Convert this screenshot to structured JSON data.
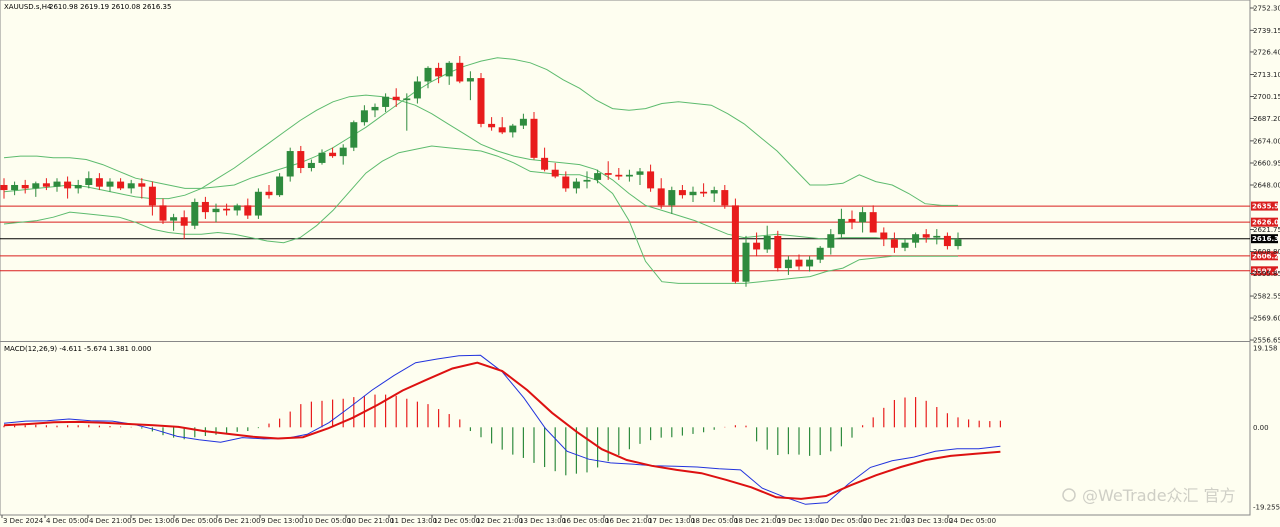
{
  "colors": {
    "background": "#fefef0",
    "bull": "#2e8b3e",
    "bear": "#e81c1c",
    "bands": "#5dbb6e",
    "level": "#d91e1e",
    "current": "#000000",
    "macd_line": "#2233dd",
    "signal_line": "#dd1111"
  },
  "chart_data": [
    {
      "type": "candlestick",
      "symbol_label": "XAUUSD.s,H4",
      "ohlc_label": "2610.98 2619.19 2610.08 2616.35",
      "ylim": [
        2556.65,
        2752.3
      ],
      "y_ticks": [
        "2752.30",
        "2739.15",
        "2726.40",
        "2713.10",
        "2700.15",
        "2687.20",
        "2674.00",
        "2660.95",
        "2648.00",
        "2621.75",
        "2608.80",
        "2595.85",
        "2582.55",
        "2569.60",
        "2556.65"
      ],
      "price_levels": [
        {
          "value": 2635.57,
          "label": "2635.57"
        },
        {
          "value": 2626.09,
          "label": "2626.09"
        },
        {
          "value": 2606.26,
          "label": "2606.26"
        },
        {
          "value": 2597.43,
          "label": "2597.43"
        }
      ],
      "current_price": {
        "value": 2616.35,
        "label": "2616.35"
      },
      "candles": [
        [
          2648,
          2652,
          2640,
          2645
        ],
        [
          2645,
          2650,
          2642,
          2648
        ],
        [
          2648,
          2651,
          2643,
          2646
        ],
        [
          2646,
          2650,
          2641,
          2649
        ],
        [
          2649,
          2652,
          2645,
          2647
        ],
        [
          2647,
          2652,
          2644,
          2650
        ],
        [
          2650,
          2653,
          2640,
          2646
        ],
        [
          2646,
          2651,
          2643,
          2648
        ],
        [
          2648,
          2656,
          2646,
          2652
        ],
        [
          2652,
          2655,
          2645,
          2647
        ],
        [
          2647,
          2652,
          2644,
          2650
        ],
        [
          2650,
          2652,
          2645,
          2646
        ],
        [
          2646,
          2651,
          2643,
          2649
        ],
        [
          2649,
          2652,
          2640,
          2647
        ],
        [
          2647,
          2650,
          2630,
          2636
        ],
        [
          2636,
          2640,
          2625,
          2627
        ],
        [
          2627,
          2631,
          2621,
          2629
        ],
        [
          2629,
          2633,
          2616,
          2624
        ],
        [
          2624,
          2640,
          2622,
          2638
        ],
        [
          2638,
          2641,
          2628,
          2632
        ],
        [
          2632,
          2637,
          2626,
          2634
        ],
        [
          2634,
          2637,
          2630,
          2633
        ],
        [
          2633,
          2637,
          2630,
          2636
        ],
        [
          2636,
          2640,
          2628,
          2630
        ],
        [
          2630,
          2646,
          2628,
          2644
        ],
        [
          2644,
          2648,
          2640,
          2642
        ],
        [
          2642,
          2655,
          2641,
          2653
        ],
        [
          2653,
          2670,
          2650,
          2668
        ],
        [
          2668,
          2671,
          2655,
          2658
        ],
        [
          2658,
          2663,
          2656,
          2661
        ],
        [
          2661,
          2669,
          2660,
          2667
        ],
        [
          2667,
          2670,
          2664,
          2665
        ],
        [
          2665,
          2672,
          2660,
          2670
        ],
        [
          2670,
          2686,
          2668,
          2685
        ],
        [
          2685,
          2695,
          2683,
          2692
        ],
        [
          2692,
          2696,
          2688,
          2694
        ],
        [
          2694,
          2702,
          2691,
          2700
        ],
        [
          2700,
          2705,
          2694,
          2698
        ],
        [
          2698,
          2702,
          2680,
          2699
        ],
        [
          2699,
          2712,
          2696,
          2709
        ],
        [
          2709,
          2718,
          2705,
          2717
        ],
        [
          2717,
          2720,
          2708,
          2712
        ],
        [
          2712,
          2721,
          2707,
          2720
        ],
        [
          2720,
          2724,
          2708,
          2709
        ],
        [
          2709,
          2715,
          2698,
          2711
        ],
        [
          2711,
          2714,
          2682,
          2684
        ],
        [
          2684,
          2688,
          2680,
          2682
        ],
        [
          2682,
          2688,
          2678,
          2679
        ],
        [
          2679,
          2684,
          2676,
          2683
        ],
        [
          2683,
          2690,
          2681,
          2687
        ],
        [
          2687,
          2691,
          2663,
          2664
        ],
        [
          2664,
          2670,
          2656,
          2657
        ],
        [
          2657,
          2661,
          2652,
          2653
        ],
        [
          2653,
          2656,
          2644,
          2646
        ],
        [
          2646,
          2652,
          2643,
          2650
        ],
        [
          2650,
          2656,
          2646,
          2651
        ],
        [
          2651,
          2657,
          2649,
          2655
        ],
        [
          2655,
          2662,
          2651,
          2654
        ],
        [
          2654,
          2658,
          2651,
          2653
        ],
        [
          2653,
          2657,
          2650,
          2654
        ],
        [
          2654,
          2658,
          2648,
          2656
        ],
        [
          2656,
          2660,
          2644,
          2646
        ],
        [
          2646,
          2652,
          2634,
          2636
        ],
        [
          2636,
          2647,
          2631,
          2645
        ],
        [
          2645,
          2648,
          2640,
          2642
        ],
        [
          2642,
          2647,
          2638,
          2644
        ],
        [
          2644,
          2649,
          2641,
          2643
        ],
        [
          2643,
          2647,
          2638,
          2645
        ],
        [
          2645,
          2648,
          2634,
          2636
        ],
        [
          2636,
          2640,
          2590,
          2591
        ],
        [
          2591,
          2618,
          2588,
          2614
        ],
        [
          2614,
          2620,
          2606,
          2610
        ],
        [
          2610,
          2624,
          2608,
          2618
        ],
        [
          2618,
          2621,
          2597,
          2599
        ],
        [
          2599,
          2606,
          2595,
          2604
        ],
        [
          2604,
          2607,
          2598,
          2600
        ],
        [
          2600,
          2606,
          2597,
          2604
        ],
        [
          2604,
          2612,
          2602,
          2611
        ],
        [
          2611,
          2622,
          2607,
          2619
        ],
        [
          2619,
          2634,
          2617,
          2628
        ],
        [
          2628,
          2633,
          2622,
          2626
        ],
        [
          2626,
          2635,
          2620,
          2632
        ],
        [
          2632,
          2636,
          2621,
          2620
        ],
        [
          2620,
          2623,
          2612,
          2616
        ],
        [
          2616,
          2620,
          2608,
          2611
        ],
        [
          2611,
          2616,
          2609,
          2614
        ],
        [
          2614,
          2620,
          2611,
          2619
        ],
        [
          2619,
          2622,
          2614,
          2617
        ],
        [
          2617,
          2622,
          2613,
          2618
        ],
        [
          2618,
          2620,
          2610,
          2612
        ],
        [
          2612,
          2620,
          2610,
          2616
        ]
      ],
      "band_upper": [
        2664,
        2665,
        2665,
        2664,
        2664,
        2663,
        2660,
        2656,
        2652,
        2650,
        2648,
        2646,
        2646,
        2647,
        2648,
        2652,
        2655,
        2658,
        2661,
        2665,
        2670,
        2676,
        2682,
        2689,
        2696,
        2703,
        2709,
        2714,
        2718,
        2721,
        2723,
        2722,
        2720,
        2716,
        2710,
        2705,
        2698,
        2693,
        2692,
        2693,
        2696,
        2697,
        2696,
        2695,
        2690,
        2684,
        2676,
        2668,
        2658,
        2648,
        2648,
        2649,
        2654,
        2650,
        2648,
        2643,
        2637,
        2636,
        2636
      ],
      "band_middle": [
        2644,
        2645,
        2646,
        2647,
        2648,
        2647,
        2645,
        2643,
        2641,
        2640,
        2640,
        2642,
        2646,
        2652,
        2658,
        2665,
        2672,
        2679,
        2686,
        2692,
        2697,
        2700,
        2701,
        2700,
        2698,
        2695,
        2690,
        2684,
        2678,
        2672,
        2668,
        2665,
        2663,
        2662,
        2661,
        2660,
        2657,
        2651,
        2643,
        2636,
        2633,
        2630,
        2627,
        2623,
        2619,
        2617,
        2618,
        2619,
        2618,
        2617,
        2616,
        2617,
        2617,
        2617,
        2616,
        2616,
        2616,
        2616,
        2616
      ],
      "band_lower": [
        2625,
        2626,
        2627,
        2629,
        2632,
        2631,
        2630,
        2629,
        2626,
        2622,
        2620,
        2619,
        2619,
        2620,
        2619,
        2617,
        2615,
        2614,
        2617,
        2624,
        2633,
        2644,
        2655,
        2662,
        2667,
        2669,
        2671,
        2670,
        2669,
        2668,
        2665,
        2661,
        2656,
        2655,
        2654,
        2654,
        2651,
        2643,
        2627,
        2603,
        2591,
        2590,
        2590,
        2590,
        2590,
        2590,
        2591,
        2592,
        2593,
        2594,
        2597,
        2599,
        2604,
        2605,
        2606,
        2606,
        2606,
        2606,
        2606
      ],
      "x_labels": [
        "3 Dec 2024",
        "4 Dec 05:00",
        "4 Dec 21:00",
        "5 Dec 13:00",
        "6 Dec 05:00",
        "6 Dec 21:00",
        "9 Dec 13:00",
        "10 Dec 05:00",
        "10 Dec 21:00",
        "11 Dec 13:00",
        "12 Dec 05:00",
        "12 Dec 21:00",
        "13 Dec 13:00",
        "16 Dec 05:00",
        "16 Dec 21:00",
        "17 Dec 13:00",
        "18 Dec 05:00",
        "18 Dec 21:00",
        "19 Dec 13:00",
        "20 Dec 05:00",
        "20 Dec 21:00",
        "23 Dec 13:00",
        "24 Dec 05:00"
      ]
    },
    {
      "type": "macd",
      "label": "MACD(12,26,9) -4.611 -5.674 1.381 0.000",
      "ylim": [
        -19.255,
        19.158
      ],
      "y_ticks": [
        "19.158",
        "0.00",
        "-19.255"
      ],
      "histogram": [
        0.4,
        0.4,
        0.5,
        0.6,
        0.5,
        0.4,
        0.5,
        0.5,
        0.6,
        0.4,
        0.3,
        0.2,
        0.1,
        -0.3,
        -1.0,
        -1.9,
        -2.5,
        -2.9,
        -2.4,
        -2.1,
        -1.8,
        -1.4,
        -1.1,
        -0.9,
        -0.2,
        0.9,
        2.1,
        3.8,
        5.6,
        6.2,
        6.4,
        6.7,
        6.9,
        7.3,
        7.6,
        7.9,
        7.9,
        7.6,
        6.9,
        6.2,
        5.6,
        4.4,
        3.2,
        1.9,
        -0.9,
        -2.4,
        -3.9,
        -5.4,
        -6.6,
        -7.4,
        -8.6,
        -9.6,
        -10.6,
        -11.6,
        -11.2,
        -10.9,
        -9.7,
        -8.2,
        -6.7,
        -5.3,
        -4.0,
        -3.1,
        -2.5,
        -2.4,
        -2.0,
        -1.6,
        -1.2,
        -0.6,
        0.1,
        0.5,
        0.4,
        -3.4,
        -5.4,
        -6.7,
        -6.5,
        -6.6,
        -6.9,
        -6.7,
        -5.8,
        -4.6,
        -2.5,
        0.5,
        2.4,
        4.7,
        6.6,
        7.2,
        7.3,
        6.4,
        4.9,
        3.4,
        2.4,
        1.9,
        1.6,
        1.5,
        1.6
      ],
      "macd_line": [
        1,
        1.5,
        1.6,
        2,
        1.6,
        1.5,
        0.7,
        -0.6,
        -2.2,
        -3,
        -3.6,
        -2.5,
        -2.8,
        -2.7,
        -1.7,
        1.1,
        5,
        9,
        12.5,
        15.6,
        16.5,
        17.3,
        17.4,
        13.4,
        7.1,
        -0.3,
        -5.8,
        -7.7,
        -8.6,
        -8.9,
        -9.3,
        -9.4,
        -9.6,
        -10,
        -10.3,
        -14.7,
        -16.8,
        -18.6,
        -18.2,
        -13.6,
        -9.7,
        -8.1,
        -7.2,
        -5.8,
        -5.2,
        -5.2,
        -4.6
      ],
      "signal_line": [
        0.5,
        0.8,
        1.2,
        1.3,
        1.1,
        0.8,
        0.5,
        0.1,
        -0.9,
        -1.6,
        -2.3,
        -2.7,
        -2.4,
        -0.3,
        2.3,
        5.4,
        8.9,
        11.6,
        14.2,
        15.6,
        13.6,
        9,
        3.5,
        -1.1,
        -5.3,
        -7.9,
        -9.3,
        -10.3,
        -11.1,
        -12.7,
        -14.5,
        -16.9,
        -17.3,
        -16.6,
        -14,
        -11.6,
        -9.6,
        -7.9,
        -6.9,
        -6.4,
        -5.9
      ]
    }
  ],
  "watermark": "@WeTrade众汇 官方"
}
